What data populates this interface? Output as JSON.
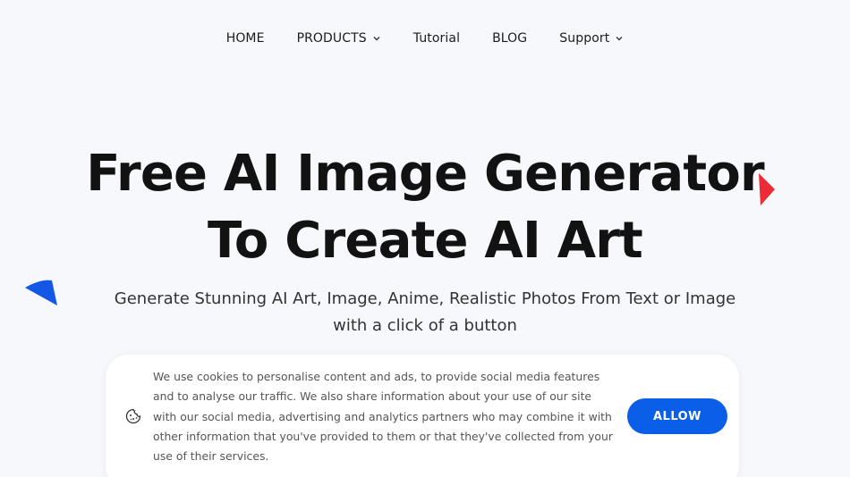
{
  "nav": {
    "items": [
      {
        "label": "HOME",
        "dropdown": false
      },
      {
        "label": "PRODUCTS",
        "dropdown": true
      },
      {
        "label": "Tutorial",
        "dropdown": false
      },
      {
        "label": "BLOG",
        "dropdown": false
      },
      {
        "label": "Support",
        "dropdown": true
      }
    ]
  },
  "hero": {
    "title_line1": "Free AI Image Generator",
    "title_line2": "To Create AI Art",
    "subtitle_line1": "Generate Stunning AI Art, Image, Anime, Realistic Photos From Text or Image",
    "subtitle_line2": "with a click of a button"
  },
  "cookie_banner": {
    "icon": "cookie-icon",
    "text": "We use cookies to personalise content and ads, to provide social media features and to analyse our traffic. We also share information about your use of our site with our social media, advertising and analytics partners who may combine it with other information that you've provided to them or that they've collected from your use of their services.",
    "allow_label": "ALLOW"
  },
  "colors": {
    "background": "#f7f8fb",
    "accent_blue": "#0b5ee8",
    "deco_red": "#ee2a35",
    "deco_blue": "#1457e6"
  }
}
